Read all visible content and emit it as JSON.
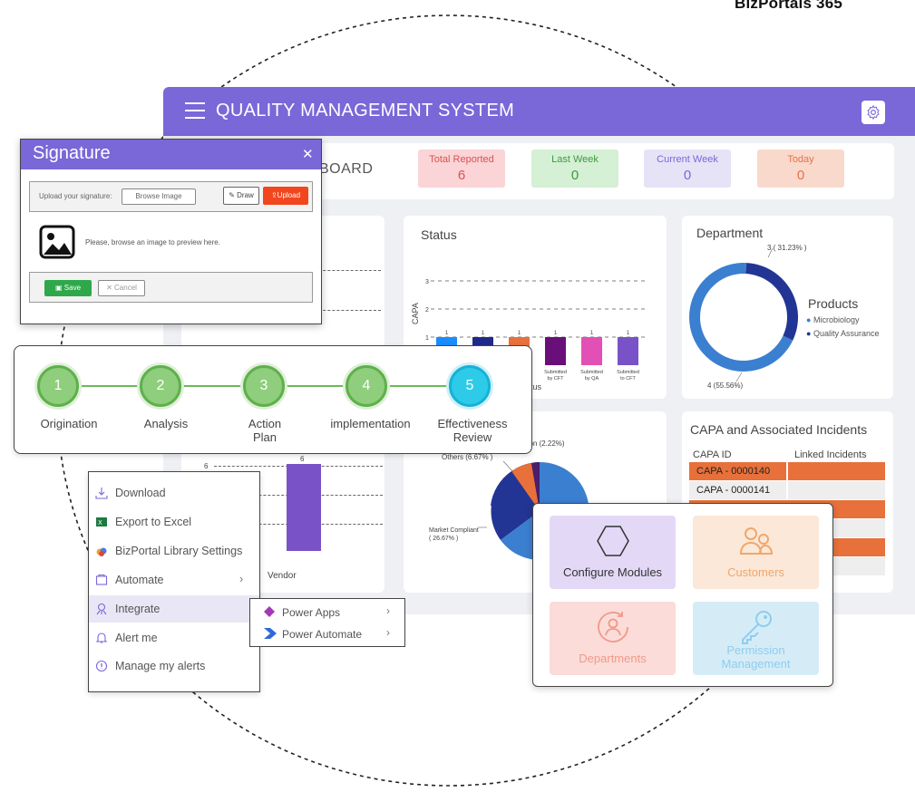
{
  "brand": "BizPortals 365",
  "app": {
    "title": "QUALITY MANAGEMENT SYSTEM",
    "dashboard_title": "BOARD"
  },
  "stats": [
    {
      "label": "Total Reported",
      "value": "6",
      "bg": "#fad4d6",
      "fg": "#d9534f"
    },
    {
      "label": "Last Week",
      "value": "0",
      "bg": "#d5f0d5",
      "fg": "#3d9a3d"
    },
    {
      "label": "Current Week",
      "value": "0",
      "bg": "#e6e3f7",
      "fg": "#7a67d8"
    },
    {
      "label": "Today",
      "value": "0",
      "bg": "#f9d9cc",
      "fg": "#e8714a"
    }
  ],
  "status_chart": {
    "title": "Status",
    "ylabel": "CAPA",
    "xlabel_partial": "atus",
    "y_ticks": [
      "1",
      "2",
      "3"
    ],
    "bars": [
      {
        "label": "",
        "value": 1,
        "color": "#1a8cff"
      },
      {
        "label": "",
        "value": 1,
        "color": "#1e2a8a"
      },
      {
        "label": "",
        "value": 1,
        "color": "#e8703a"
      },
      {
        "label": "Submitted by CFT",
        "value": 1,
        "color": "#6a0f7a"
      },
      {
        "label": "Submitted by QA",
        "value": 1,
        "color": "#e24fb5"
      },
      {
        "label": "Submitted to CFT",
        "value": 1,
        "color": "#7a52c7"
      }
    ]
  },
  "department_chart": {
    "title": "Department",
    "label_top": "3 ( 31.23% )",
    "label_bottom": "4 (55.56%)",
    "legend_title": "Products",
    "legend": [
      {
        "name": "Microbiology",
        "color": "#3b7fd0"
      },
      {
        "name": "Quality Assurance",
        "color": "#233594"
      }
    ],
    "slices": [
      {
        "name": "Microbiology",
        "pct": 68.77,
        "color": "#3b7fd0"
      },
      {
        "name": "Quality Assurance",
        "pct": 31.23,
        "color": "#233594"
      }
    ]
  },
  "vendor_chart": {
    "value_label": "6",
    "y_tick": "6",
    "xlabel": "Vendor",
    "bar_color": "#7a52c7"
  },
  "pie_chart": {
    "labels": {
      "a": "ation (2.22%)",
      "b": "Others (6.67% )",
      "c": "Market Compliant",
      "d": "( 26.67% )"
    }
  },
  "capa_table": {
    "title": "CAPA and Associated Incidents",
    "col1": "CAPA ID",
    "col2": "Linked Incidents",
    "rows": [
      "CAPA - 0000140",
      "CAPA - 0000141"
    ]
  },
  "signature": {
    "title": "Signature",
    "close": "✕",
    "upload_label": "Upload your signature:",
    "browse": "Browse Image",
    "draw": "Draw",
    "upload": "Upload",
    "preview_text": "Please, browse an image to preview here.",
    "save": "Save",
    "cancel": "Cancel"
  },
  "stepper": {
    "steps": [
      {
        "num": "1",
        "label": "Origination"
      },
      {
        "num": "2",
        "label": "Analysis"
      },
      {
        "num": "3",
        "label": "Action Plan"
      },
      {
        "num": "4",
        "label": "implementation"
      },
      {
        "num": "5",
        "label": "Effectiveness Review"
      }
    ]
  },
  "menu": {
    "items": [
      {
        "label": "Download",
        "icon": "download-icon"
      },
      {
        "label": "Export to Excel",
        "icon": "excel-icon"
      },
      {
        "label": "BizPortal Library Settings",
        "icon": "cloud-settings-icon"
      },
      {
        "label": "Automate",
        "icon": "automate-icon"
      },
      {
        "label": "Integrate",
        "icon": "integrate-icon"
      },
      {
        "label": "Alert me",
        "icon": "bell-icon"
      },
      {
        "label": "Manage my alerts",
        "icon": "manage-alerts-icon"
      }
    ],
    "submenu": [
      {
        "label": "Power Apps",
        "icon": "power-apps-icon"
      },
      {
        "label": "Power Automate",
        "icon": "power-automate-icon"
      }
    ]
  },
  "modules": [
    {
      "label": "Configure Modules",
      "bg": "#e3d9f7",
      "fg": "#333333",
      "icon": "hexagon-icon"
    },
    {
      "label": "Customers",
      "bg": "#fbe8d8",
      "fg": "#f2a669",
      "icon": "customers-icon"
    },
    {
      "label": "Departments",
      "bg": "#fbdcd8",
      "fg": "#f09a8a",
      "icon": "departments-icon"
    },
    {
      "label": "Permission Management",
      "bg": "#d5ecf7",
      "fg": "#8fcdee",
      "icon": "key-icon"
    }
  ]
}
